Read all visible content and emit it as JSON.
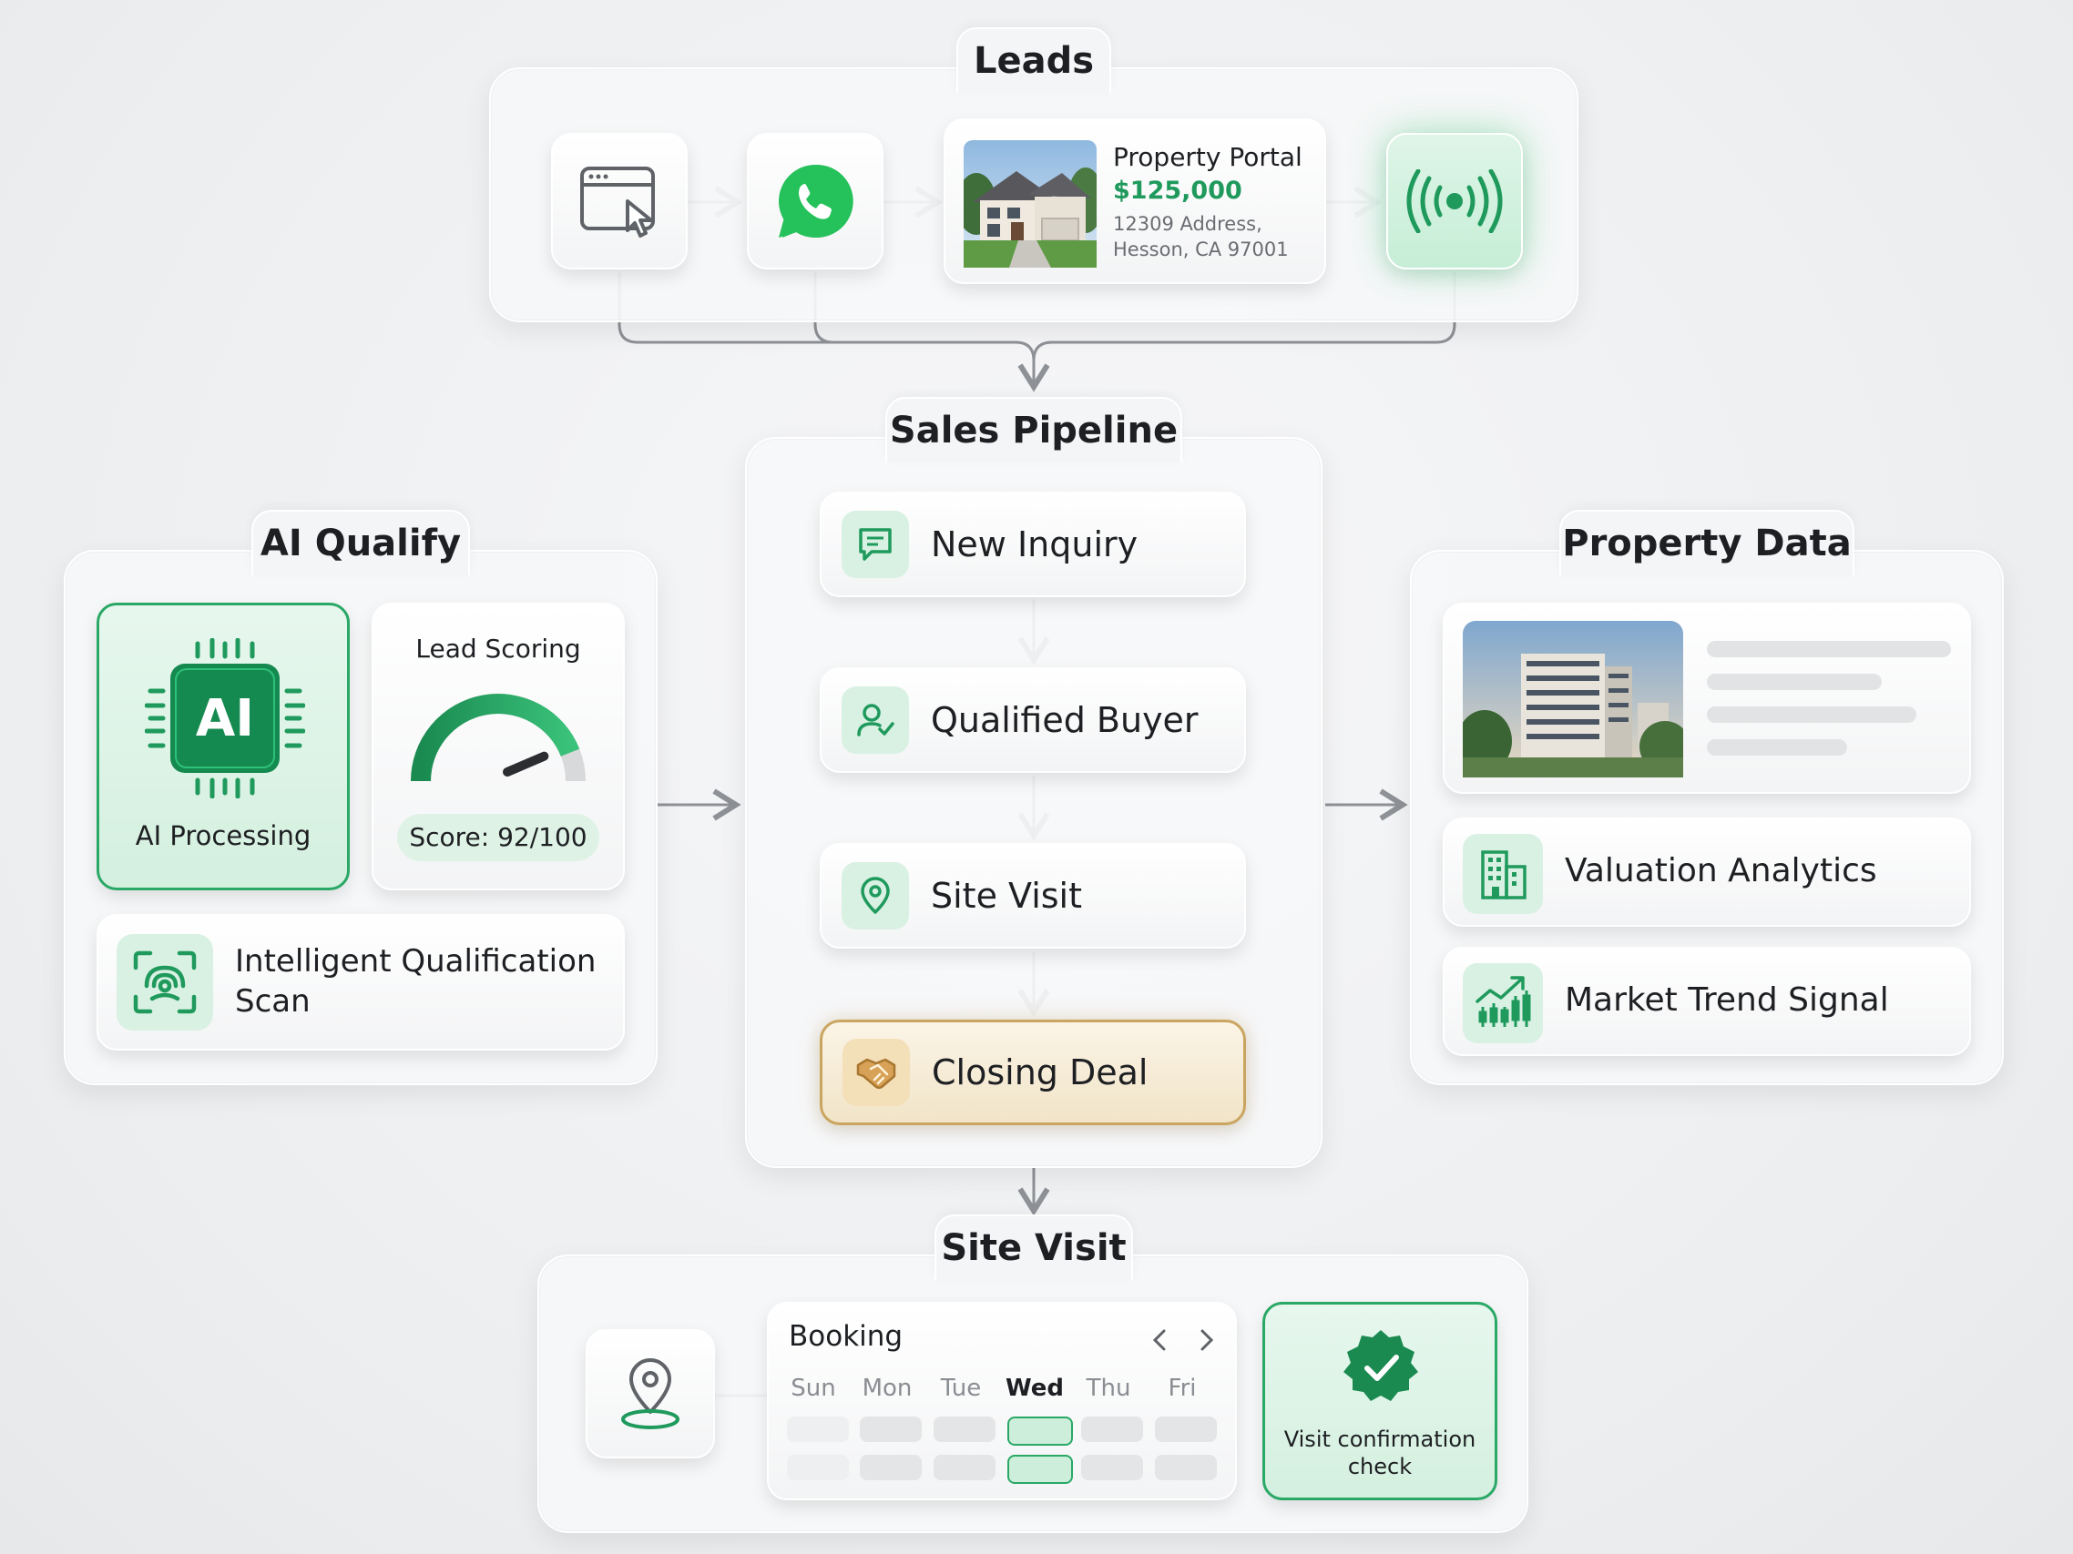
{
  "leads": {
    "title": "Leads",
    "portal_title": "Property Portal",
    "portal_price": "$125,000",
    "portal_address_line1": "12309 Address,",
    "portal_address_line2": "Hesson, CA 97001"
  },
  "pipeline": {
    "title": "Sales Pipeline",
    "stages": [
      "New Inquiry",
      "Qualified Buyer",
      "Site Visit",
      "Closing Deal"
    ]
  },
  "qualify": {
    "title": "AI Qualify",
    "ai_chip_text": "AI",
    "ai_label": "AI Processing",
    "scoring_title": "Lead Scoring",
    "score_text": "Score: 92/100",
    "score_value": 92,
    "score_max": 100,
    "scan_line1": "Intelligent Qualification",
    "scan_line2": "Scan"
  },
  "property": {
    "title": "Property Data",
    "valuation": "Valuation Analytics",
    "market": "Market Trend Signal"
  },
  "visit": {
    "title": "Site Visit",
    "booking_title": "Booking",
    "days": [
      "Sun",
      "Mon",
      "Tue",
      "Wed",
      "Thu",
      "Fri"
    ],
    "selected_day": "Wed",
    "confirm_line1": "Visit confirmation",
    "confirm_line2": "check"
  },
  "colors": {
    "accent_green": "#1f9a5c",
    "closing_gold": "#c9a560",
    "whatsapp_green": "#25c15a"
  },
  "icons": [
    "browser-click-icon",
    "whatsapp-icon",
    "broadcast-icon",
    "chat-icon",
    "user-check-icon",
    "location-pin-icon",
    "handshake-icon",
    "ai-chip-icon",
    "face-scan-icon",
    "building-icon",
    "market-chart-icon",
    "checkmark-badge-icon",
    "chevron-left-icon",
    "chevron-right-icon"
  ]
}
